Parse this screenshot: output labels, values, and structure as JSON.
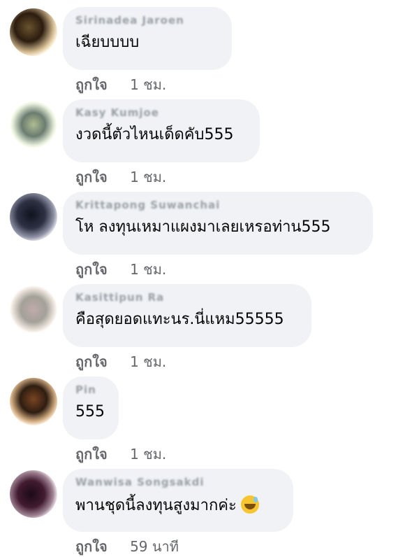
{
  "comments": [
    {
      "author": "Sirinadea Jaroen",
      "text": "เฉียบบบบ",
      "like_label": "ถูกใจ",
      "time": "1 ชม."
    },
    {
      "author": "Kasy Kumjoe",
      "text": "งวดนี้ตัวไหนเด็ดคับ555",
      "like_label": "ถูกใจ",
      "time": "1 ชม."
    },
    {
      "author": "Krittapong Suwanchai",
      "text": "โห ลงทุนเหมาแผงมาเลยเหรอท่าน555",
      "like_label": "ถูกใจ",
      "time": "1 ชม."
    },
    {
      "author": "Kasittipun Ra",
      "text": "คือสุดยอดแทะนร.นี่แหม55555",
      "like_label": "ถูกใจ",
      "time": "1 ชม."
    },
    {
      "author": "Pin",
      "text": "555",
      "like_label": "ถูกใจ",
      "time": "1 ชม."
    },
    {
      "author": "Wanwisa Songsakdi",
      "text": "พานชุดนี้ลงทุนสูงมากค่ะ",
      "emoji": "grinning-sweat",
      "like_label": "ถูกใจ",
      "time": "59 นาที"
    }
  ]
}
